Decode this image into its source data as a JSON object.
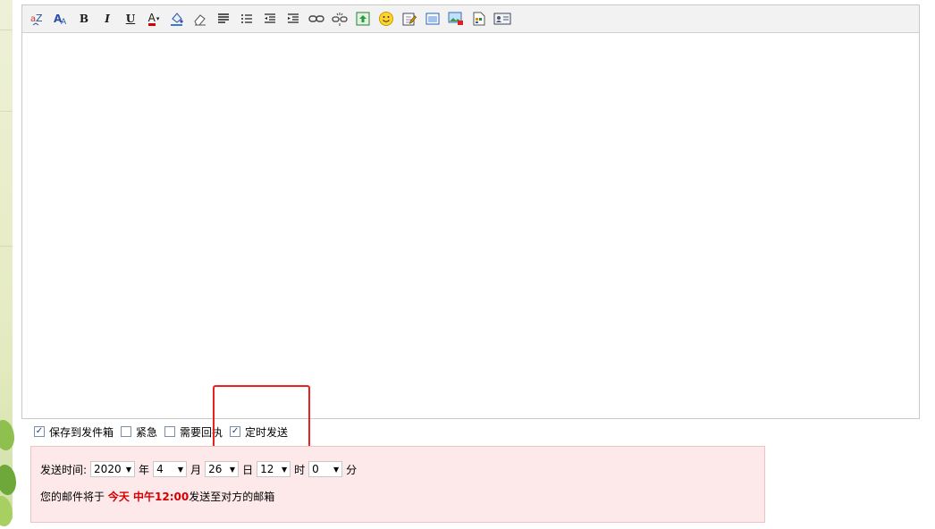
{
  "toolbar": {
    "icons": [
      "spellcheck-icon",
      "font-icon",
      "bold-icon",
      "italic-icon",
      "underline-icon",
      "text-color-icon",
      "bg-color-icon",
      "eraser-icon",
      "align-icon",
      "list-ordered-icon",
      "outdent-icon",
      "indent-icon",
      "link-icon",
      "unlink-icon",
      "upload-icon",
      "emoji-icon",
      "edit-icon",
      "window-icon",
      "image-icon",
      "doc-icon",
      "card-icon"
    ],
    "bold": "B",
    "italic": "I",
    "underline": "U",
    "font_color": "A"
  },
  "options": {
    "save_sent": {
      "label": "保存到发件箱",
      "checked": true
    },
    "urgent": {
      "label": "紧急",
      "checked": false
    },
    "receipt": {
      "label": "需要回执",
      "checked": false
    },
    "scheduled": {
      "label": "定时发送",
      "checked": true
    }
  },
  "schedule": {
    "label": "发送时间:",
    "year": "2020",
    "year_unit": "年",
    "month": "4",
    "month_unit": "月",
    "day": "26",
    "day_unit": "日",
    "hour": "12",
    "hour_unit": "时",
    "minute": "0",
    "minute_unit": "分",
    "note_prefix": "您的邮件将于",
    "note_time": "今天 中午12:00",
    "note_suffix": "发送至对方的邮箱"
  },
  "colors": {
    "highlight_box": "#e8231f",
    "panel_bg": "#fde9ea",
    "note_time": "#d40000"
  }
}
